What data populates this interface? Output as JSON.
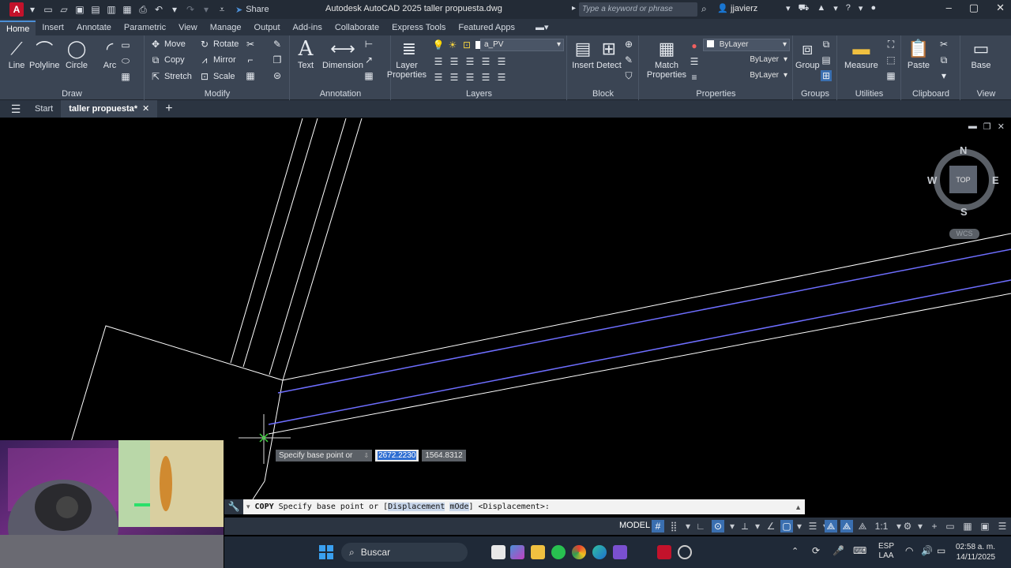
{
  "titlebar": {
    "app_letter": "A",
    "share_label": "Share",
    "title": "Autodesk AutoCAD 2025   taller propuesta.dwg",
    "search_placeholder": "Type a keyword or phrase",
    "user": "jjavierz"
  },
  "ribbon_tabs": [
    "Home",
    "Insert",
    "Annotate",
    "Parametric",
    "View",
    "Manage",
    "Output",
    "Add-ins",
    "Collaborate",
    "Express Tools",
    "Featured Apps"
  ],
  "ribbon": {
    "draw": {
      "title": "Draw",
      "line": "Line",
      "polyline": "Polyline",
      "circle": "Circle",
      "arc": "Arc"
    },
    "modify": {
      "title": "Modify",
      "move": "Move",
      "rotate": "Rotate",
      "copy": "Copy",
      "mirror": "Mirror",
      "stretch": "Stretch",
      "scale": "Scale"
    },
    "annotation": {
      "title": "Annotation",
      "text": "Text",
      "dimension": "Dimension"
    },
    "layers": {
      "title": "Layers",
      "layer_properties": "Layer Properties",
      "current_layer": "a_PV"
    },
    "block": {
      "title": "Block",
      "insert": "Insert",
      "detect": "Detect"
    },
    "properties": {
      "title": "Properties",
      "match": "Match Properties",
      "color": "ByLayer",
      "linetype": "ByLayer",
      "lineweight": "ByLayer"
    },
    "groups": {
      "title": "Groups",
      "group": "Group"
    },
    "utilities": {
      "title": "Utilities",
      "measure": "Measure"
    },
    "clipboard": {
      "title": "Clipboard",
      "paste": "Paste"
    },
    "view": {
      "title": "View",
      "base": "Base"
    }
  },
  "filetabs": {
    "start": "Start",
    "active": "taller propuesta*"
  },
  "viewcube": {
    "north": "N",
    "south": "S",
    "east": "E",
    "west": "W",
    "top": "TOP",
    "wcs": "WCS"
  },
  "tooltip": {
    "prompt": "Specify base point or",
    "x_value": "2672.2230",
    "y_value": "1564.8312"
  },
  "command": {
    "name": "COPY",
    "prompt": "Specify base point or [",
    "opt1": "Displacement",
    "opt2": "mOde",
    "suffix": "] <Displacement>:"
  },
  "status": {
    "model": "MODEL",
    "scale": "1:1"
  },
  "taskbar": {
    "search": "Buscar",
    "lang_1": "ESP",
    "lang_2": "LAA",
    "time": "02:58 a. m.",
    "date": "14/11/2025"
  },
  "colors": {
    "accent": "#4c8fd6",
    "ribbon_bg": "#3b4554",
    "canvas_bg": "#000000",
    "line_white": "#ffffff",
    "line_blue": "#6e6eff",
    "cursor_green": "#3cd23c"
  }
}
